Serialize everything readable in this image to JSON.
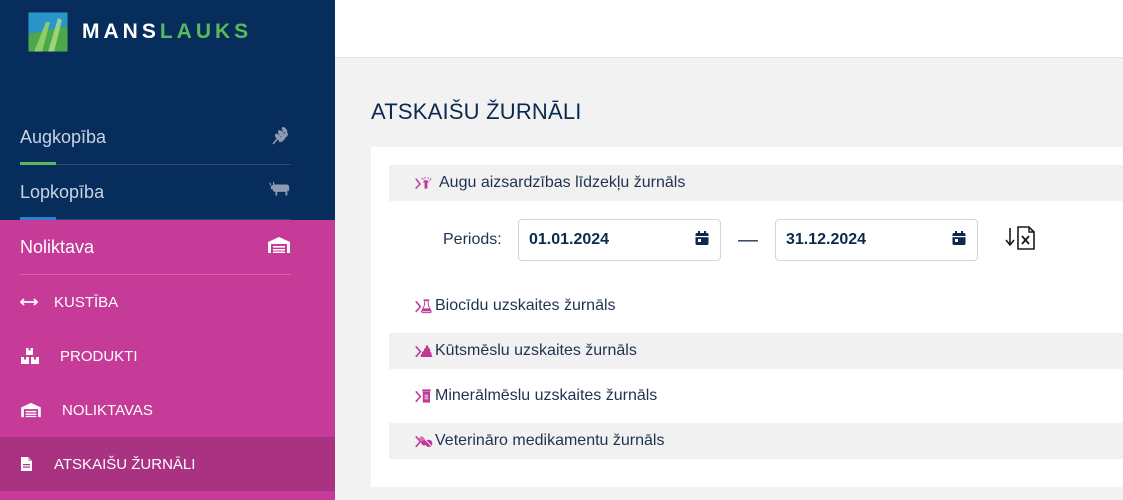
{
  "app": {
    "logo_part1": "MANS",
    "logo_part2": "LAUKS"
  },
  "sidebar": {
    "top_items": [
      {
        "label": "Augkopība",
        "indicator_color": "#5cb85c"
      },
      {
        "label": "Lopkopība",
        "indicator_color": "#2f80d0"
      }
    ],
    "section": {
      "label": "Noliktava"
    },
    "sub_items": [
      {
        "label": "KUSTĪBA"
      },
      {
        "label": "PRODUKTI"
      },
      {
        "label": "NOLIKTAVAS"
      },
      {
        "label": "ATSKAIŠU ŽURNĀLI",
        "active": true
      }
    ]
  },
  "main": {
    "title": "ATSKAIŠU ŽURNĀLI",
    "journals": [
      {
        "label": "Augu aizsardzības līdzekļu žurnāls",
        "icon": "spray-icon",
        "expanded": true
      },
      {
        "label": "Biocīdu uzskaites žurnāls",
        "icon": "flask-icon"
      },
      {
        "label": "Kūtsmēslu uzskaites žurnāls",
        "icon": "manure-icon"
      },
      {
        "label": "Minerālmēslu uzskaites žurnāls",
        "icon": "fertilizer-icon"
      },
      {
        "label": "Veterināro medikamentu žurnāls",
        "icon": "pills-icon"
      }
    ],
    "period": {
      "label": "Periods:",
      "from": "01.01.2024",
      "to": "31.12.2024",
      "separator": "—"
    }
  },
  "colors": {
    "sidebar_bg": "#062d5c",
    "accent_magenta": "#c53b97",
    "active_magenta": "#a93283",
    "icon_magenta": "#c0399a",
    "text_dark": "#0a2a4e"
  }
}
